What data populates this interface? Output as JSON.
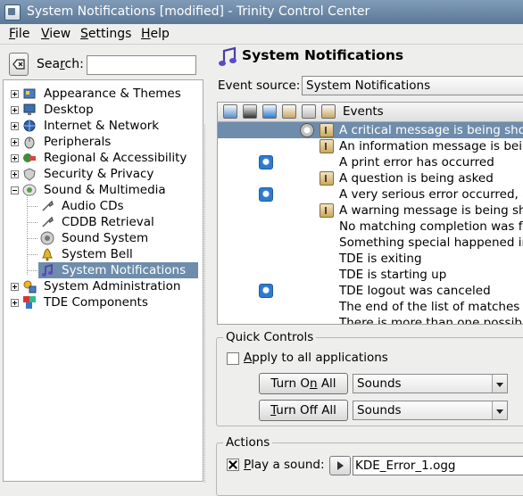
{
  "window": {
    "title": "System Notifications [modified] - Trinity Control Center"
  },
  "menubar": [
    {
      "label": "File"
    },
    {
      "label": "View"
    },
    {
      "label": "Settings"
    },
    {
      "label": "Help"
    }
  ],
  "search": {
    "label": "Search:",
    "value": ""
  },
  "tree": [
    {
      "label": "Appearance & Themes",
      "icon": "appearance-icon",
      "expander": "plus"
    },
    {
      "label": "Desktop",
      "icon": "desktop-icon",
      "expander": "plus"
    },
    {
      "label": "Internet & Network",
      "icon": "network-icon",
      "expander": "plus"
    },
    {
      "label": "Peripherals",
      "icon": "mouse-icon",
      "expander": "plus"
    },
    {
      "label": "Regional & Accessibility",
      "icon": "regional-icon",
      "expander": "plus"
    },
    {
      "label": "Security & Privacy",
      "icon": "security-icon",
      "expander": "plus"
    },
    {
      "label": "Sound & Multimedia",
      "icon": "sound-icon",
      "expander": "minus"
    },
    {
      "label": "Audio CDs",
      "icon": "wrench-icon",
      "child": true
    },
    {
      "label": "CDDB Retrieval",
      "icon": "wrench-icon",
      "child": true
    },
    {
      "label": "Sound System",
      "icon": "speaker-icon",
      "child": true
    },
    {
      "label": "System Bell",
      "icon": "bell-icon",
      "child": true
    },
    {
      "label": "System Notifications",
      "icon": "music-note-icon",
      "child": true,
      "selected": true
    },
    {
      "label": "System Administration",
      "icon": "admin-icon",
      "expander": "plus"
    },
    {
      "label": "TDE Components",
      "icon": "components-icon",
      "expander": "plus"
    }
  ],
  "header": {
    "title": "System Notifications",
    "icon": "music-note-icon"
  },
  "event_source": {
    "label": "Event source:",
    "value": "System Notifications"
  },
  "events": {
    "column_label": "Events",
    "column_icons": [
      "execute-icon",
      "terminal-icon",
      "messagebox-icon",
      "taskbar-icon",
      "passive-popup-icon",
      "sound-icon"
    ],
    "rows": [
      {
        "text": "A critical message is being shown",
        "icons": [
          "passive",
          "sound"
        ],
        "selected": true
      },
      {
        "text": "An information message is being shown",
        "icons": [
          "sound"
        ]
      },
      {
        "text": "A print error has occurred",
        "icons": [
          "info"
        ]
      },
      {
        "text": "A question is being asked",
        "icons": [
          "sound"
        ]
      },
      {
        "text": "A very serious error occurred, at least",
        "icons": [
          "info"
        ]
      },
      {
        "text": "A warning message is being shown",
        "icons": [
          "sound"
        ]
      },
      {
        "text": "No matching completion was found",
        "icons": []
      },
      {
        "text": "Something special happened in the program",
        "icons": []
      },
      {
        "text": "TDE is exiting",
        "icons": []
      },
      {
        "text": "TDE is starting up",
        "icons": []
      },
      {
        "text": "TDE logout was canceled",
        "icons": [
          "info"
        ]
      },
      {
        "text": "The end of the list of matches has been reached",
        "icons": []
      },
      {
        "text": "There is more than one possible match",
        "icons": []
      }
    ]
  },
  "quick_controls": {
    "title": "Quick Controls",
    "apply_all": {
      "label": "Apply to all applications",
      "checked": false
    },
    "turn_on": {
      "label": "Turn On All",
      "combo": "Sounds"
    },
    "turn_off": {
      "label": "Turn Off All",
      "combo": "Sounds"
    }
  },
  "actions": {
    "title": "Actions",
    "play_sound": {
      "label": "Play a sound:",
      "checked": true,
      "file": "KDE_Error_1.ogg"
    }
  },
  "colors": {
    "titlebar": "#6a87a6",
    "selection": "#6e8cab",
    "window_bg": "#eeeeec"
  }
}
